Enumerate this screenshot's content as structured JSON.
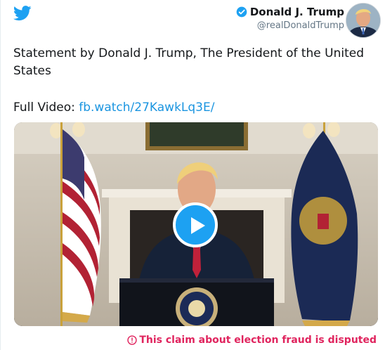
{
  "author": {
    "name": "Donald J. Trump",
    "handle": "@realDonaldTrump"
  },
  "tweet": {
    "text": "Statement by Donald J. Trump, The President of the United States",
    "video_prefix": "Full Video:",
    "video_link": "fb.watch/27KawkLq3E/"
  },
  "media": {
    "type": "video"
  },
  "notice": {
    "text": "This claim about election fraud is disputed"
  },
  "icons": [
    "twitter-bird-icon",
    "verified-badge-icon",
    "play-icon",
    "alert-circle-icon"
  ],
  "colors": {
    "brand_blue": "#1da1f2",
    "link_blue": "#1b95e0",
    "warning_red": "#e0245e",
    "handle_gray": "#657786"
  }
}
